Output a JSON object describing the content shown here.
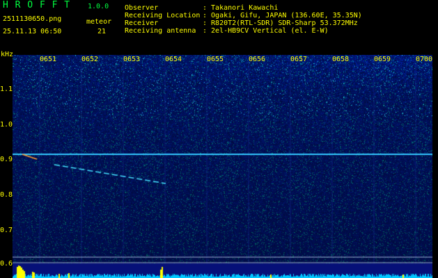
{
  "header": {
    "app_name": "H R O F F T",
    "version": "1.0.0",
    "filename": "2511130650.png",
    "datetime": "25.11.13 06:50",
    "meteor_label": "meteor",
    "meteor_count": "21",
    "info_labels": [
      "Observer",
      "Receiving Location",
      "Receiver",
      "Receiving antenna"
    ],
    "info_values": [
      ": Takanori Kawachi",
      ": Ogaki, Gifu, JAPAN (136.60E, 35.35N)",
      ": R820T2(RTL-SDR) SDR-Sharp 53.372MHz",
      ": 2el-HB9CV Vertical (el. E-W)"
    ]
  },
  "axis": {
    "unit": "kHz",
    "y_ticks": [
      "1.1",
      "1.0",
      "0.9",
      "0.8",
      "0.7",
      "0.6"
    ],
    "x_ticks": [
      "0651",
      "0652",
      "0653",
      "0654",
      "0655",
      "0656",
      "0657",
      "0658",
      "0659",
      "0700"
    ]
  },
  "colors": {
    "background": "#000000",
    "header_text": "#ffff00",
    "title_text": "#00ff40",
    "spectrogram_base": "#0a1a8a",
    "signal": "#00ffff",
    "level_bars": "#ffff00"
  }
}
